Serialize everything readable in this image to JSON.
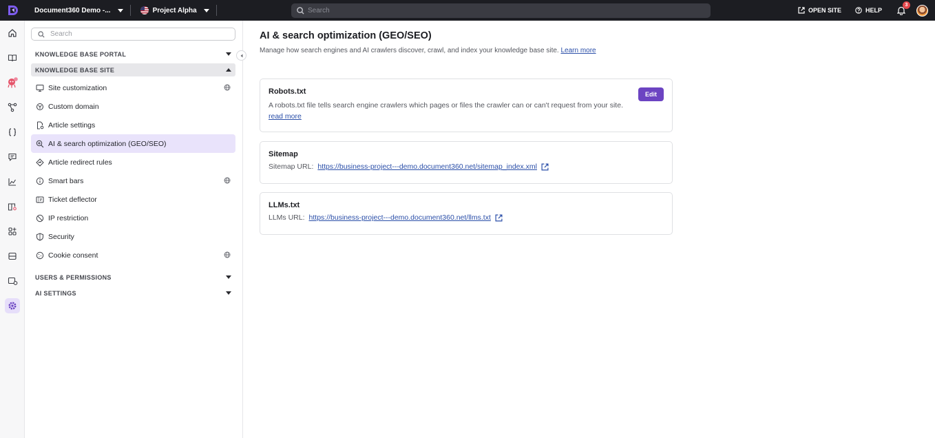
{
  "topbar": {
    "project_name": "Document360 Demo -...",
    "workspace_name": "Project Alpha",
    "search_placeholder": "Search",
    "open_site_label": "OPEN SITE",
    "help_label": "HELP",
    "notification_count": "3"
  },
  "sidebar": {
    "search_placeholder": "Search",
    "sections": {
      "kb_portal": "KNOWLEDGE BASE PORTAL",
      "kb_site": "KNOWLEDGE BASE SITE",
      "users": "USERS & PERMISSIONS",
      "ai": "AI SETTINGS"
    },
    "items": [
      {
        "label": "Site customization",
        "icon": "monitor-icon",
        "globe": true
      },
      {
        "label": "Custom domain",
        "icon": "domain-icon",
        "globe": false
      },
      {
        "label": "Article settings",
        "icon": "document-settings-icon",
        "globe": false
      },
      {
        "label": "AI & search optimization (GEO/SEO)",
        "icon": "search-optimization-icon",
        "globe": false,
        "active": true
      },
      {
        "label": "Article redirect rules",
        "icon": "redirect-icon",
        "globe": false
      },
      {
        "label": "Smart bars",
        "icon": "info-icon",
        "globe": true
      },
      {
        "label": "Ticket deflector",
        "icon": "ticket-icon",
        "globe": false
      },
      {
        "label": "IP restriction",
        "icon": "block-icon",
        "globe": false
      },
      {
        "label": "Security",
        "icon": "shield-icon",
        "globe": false
      },
      {
        "label": "Cookie consent",
        "icon": "cookie-icon",
        "globe": true
      }
    ]
  },
  "main": {
    "title": "AI & search optimization (GEO/SEO)",
    "description": "Manage how search engines and AI crawlers discover, crawl, and index your knowledge base site.",
    "learn_more": "Learn more",
    "robots": {
      "title": "Robots.txt",
      "text": "A robots.txt file tells search engine crawlers which pages or files the crawler can or can't request from your site.",
      "read_more": "read more",
      "edit_label": "Edit"
    },
    "sitemap": {
      "title": "Sitemap",
      "label": "Sitemap URL:",
      "url": "https://business-project---demo.document360.net/sitemap_index.xml"
    },
    "llms": {
      "title": "LLMs.txt",
      "label": "LLMs URL:",
      "url": "https://business-project---demo.document360.net/llms.txt"
    }
  },
  "colors": {
    "accent": "#6c44c2",
    "topbar": "#1c1d22",
    "active_bg": "#e9e3fb"
  }
}
